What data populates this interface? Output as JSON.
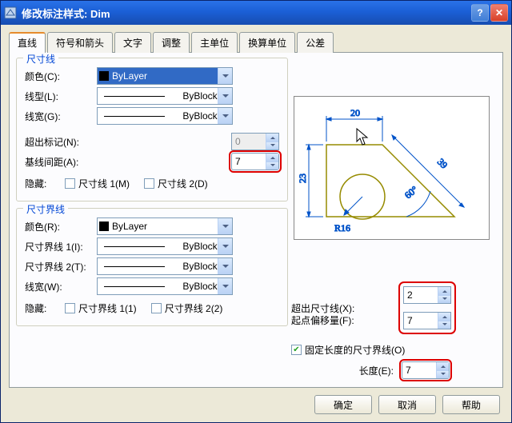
{
  "window": {
    "title": "修改标注样式: Dim"
  },
  "tabs": [
    "直线",
    "符号和箭头",
    "文字",
    "调整",
    "主单位",
    "换算单位",
    "公差"
  ],
  "active_tab": 0,
  "dim_line": {
    "legend": "尺寸线",
    "color_label": "颜色(C):",
    "color_value": "ByLayer",
    "linetype_label": "线型(L):",
    "linetype_value": "ByBlock",
    "lineweight_label": "线宽(G):",
    "lineweight_value": "ByBlock",
    "ext_mark_label": "超出标记(N):",
    "ext_mark_value": "0",
    "baseline_label": "基线间距(A):",
    "baseline_value": "7",
    "hide_label": "隐藏:",
    "hide1": "尺寸线 1(M)",
    "hide2": "尺寸线 2(D)"
  },
  "ext_line": {
    "legend": "尺寸界线",
    "color_label": "颜色(R):",
    "color_value": "ByLayer",
    "ext1_label": "尺寸界线 1(I):",
    "ext1_value": "ByBlock",
    "ext2_label": "尺寸界线 2(T):",
    "ext2_value": "ByBlock",
    "lineweight_label": "线宽(W):",
    "lineweight_value": "ByBlock",
    "hide_label": "隐藏:",
    "hide1": "尺寸界线 1(1)",
    "hide2": "尺寸界线 2(2)"
  },
  "right": {
    "beyond_label": "超出尺寸线(X):",
    "beyond_value": "2",
    "offset_label": "起点偏移量(F):",
    "offset_value": "7",
    "fixed_label": "固定长度的尺寸界线(O)",
    "fixed_checked": true,
    "length_label": "长度(E):",
    "length_value": "7"
  },
  "preview": {
    "d20": "20",
    "d23": "23",
    "d39": "39",
    "r16": "R16",
    "a60": "60°"
  },
  "buttons": {
    "ok": "确定",
    "cancel": "取消",
    "help": "帮助"
  }
}
